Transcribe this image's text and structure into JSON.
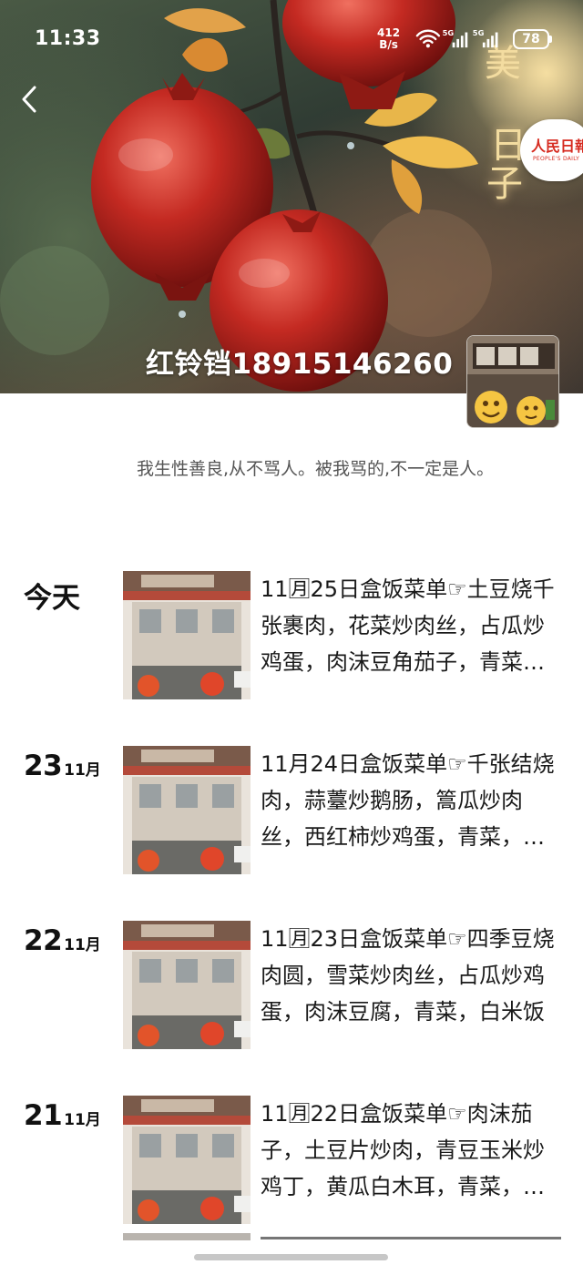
{
  "status_bar": {
    "time": "11:33",
    "net_speed_value": "412",
    "net_speed_unit": "B/s",
    "signal_1": "5G",
    "signal_2": "5G",
    "battery": "78"
  },
  "cover": {
    "title": "红铃铛18915146260",
    "decorative_text": [
      "美",
      "日",
      "子"
    ],
    "badge_name": "人民日報",
    "badge_sub": "PEOPLE'S DAILY"
  },
  "profile": {
    "signature": "我生性善良,从不骂人。被我骂的,不一定是人。"
  },
  "posts": [
    {
      "date_label": "今天",
      "day": "",
      "month": "",
      "text": "11🈷25日盒饭菜单☞土豆烧千张裹肉，花菜炒肉丝，占瓜炒鸡蛋，肉沫豆角茄子，青菜，白米饭"
    },
    {
      "date_label": "",
      "day": "23",
      "month": "11月",
      "text": "11月24日盒饭菜单☞千张结烧肉，蒜薹炒鹅肠，篙瓜炒肉丝，西红柿炒鸡蛋，青菜，白米饭"
    },
    {
      "date_label": "",
      "day": "22",
      "month": "11月",
      "text": "11🈷23日盒饭菜单☞四季豆烧肉圆，雪菜炒肉丝，占瓜炒鸡蛋，肉沫豆腐，青菜，白米饭"
    },
    {
      "date_label": "",
      "day": "21",
      "month": "11月",
      "text": "11🈷22日盒饭菜单☞肉沫茄子，土豆片炒肉，青豆玉米炒鸡丁，黄瓜白木耳，青菜，白米饭"
    }
  ],
  "colors": {
    "accent_red": "#d62b20",
    "text_primary": "#111111",
    "text_secondary": "#555555"
  }
}
